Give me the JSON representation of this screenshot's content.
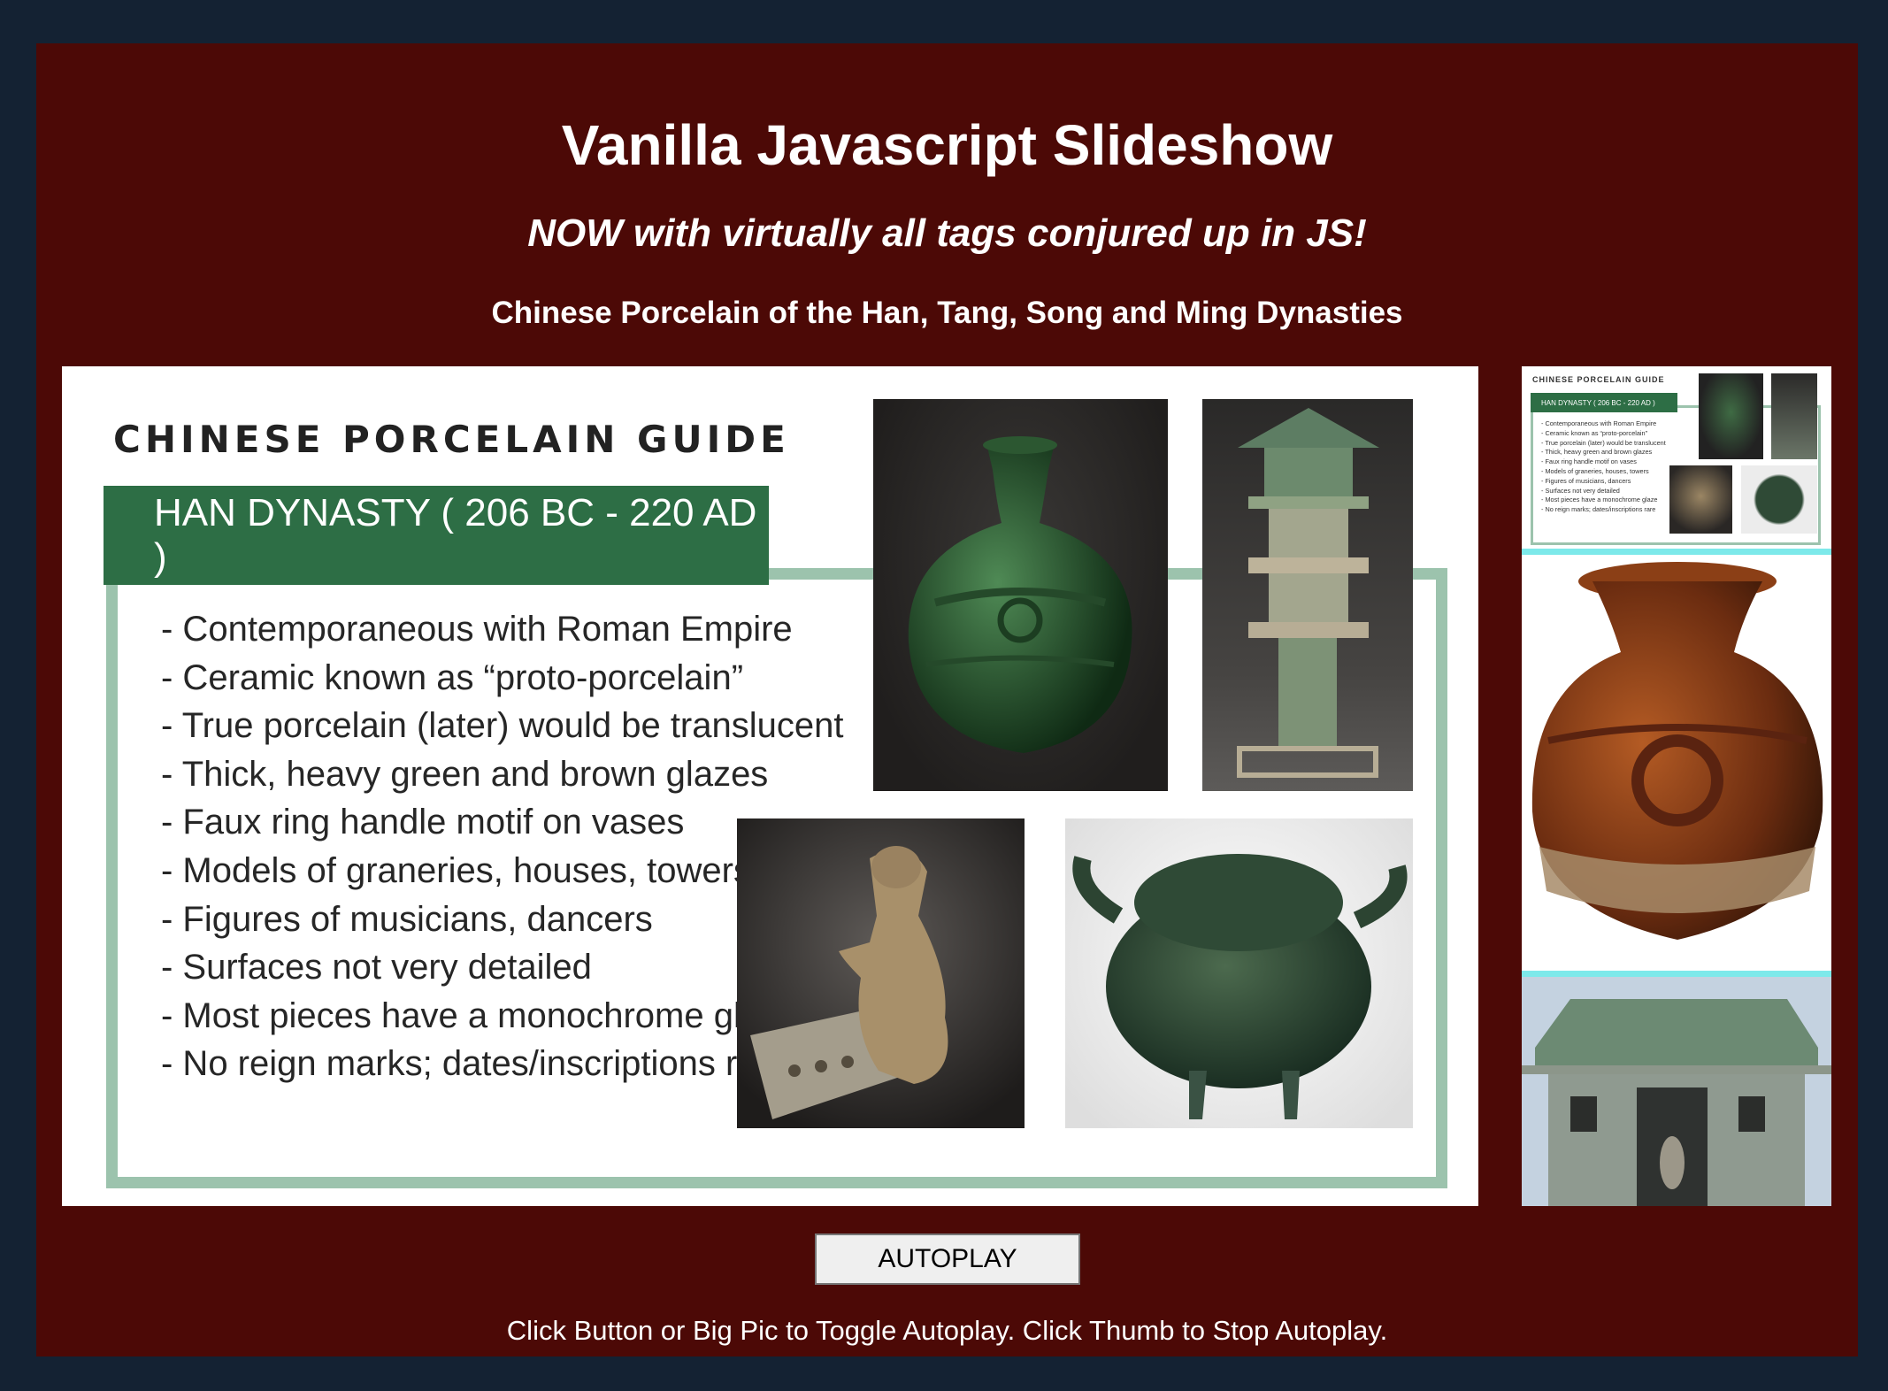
{
  "header": {
    "title": "Vanilla Javascript Slideshow",
    "subtitle": "NOW with virtually all tags conjured up in JS!",
    "topic": "Chinese Porcelain of the Han, Tang, Song and Ming Dynasties"
  },
  "slide": {
    "heading": "CHINESE PORCELAIN GUIDE",
    "dynasty": "HAN DYNASTY ( 206 BC - 220 AD )",
    "facts": [
      "- Contemporaneous with Roman Empire",
      "- Ceramic known as “proto-porcelain”",
      "- True porcelain (later) would be translucent",
      "- Thick, heavy green and brown glazes",
      "- Faux ring handle motif on vases",
      "- Models of graneries, houses, towers",
      "- Figures of musicians, dancers",
      "- Surfaces not very detailed",
      "- Most pieces have a monochrome glaze",
      "- No reign marks; dates/inscriptions rare"
    ]
  },
  "controls": {
    "autoplay_label": "AUTOPLAY",
    "hint": "Click Button or Big Pic to Toggle Autoplay. Click Thumb to Stop Autoplay."
  },
  "colors": {
    "page_bg": "#142233",
    "frame_bg": "#4c0906",
    "dynasty_bar": "#2d6e45",
    "thumb_separator": "#7de9ea"
  }
}
